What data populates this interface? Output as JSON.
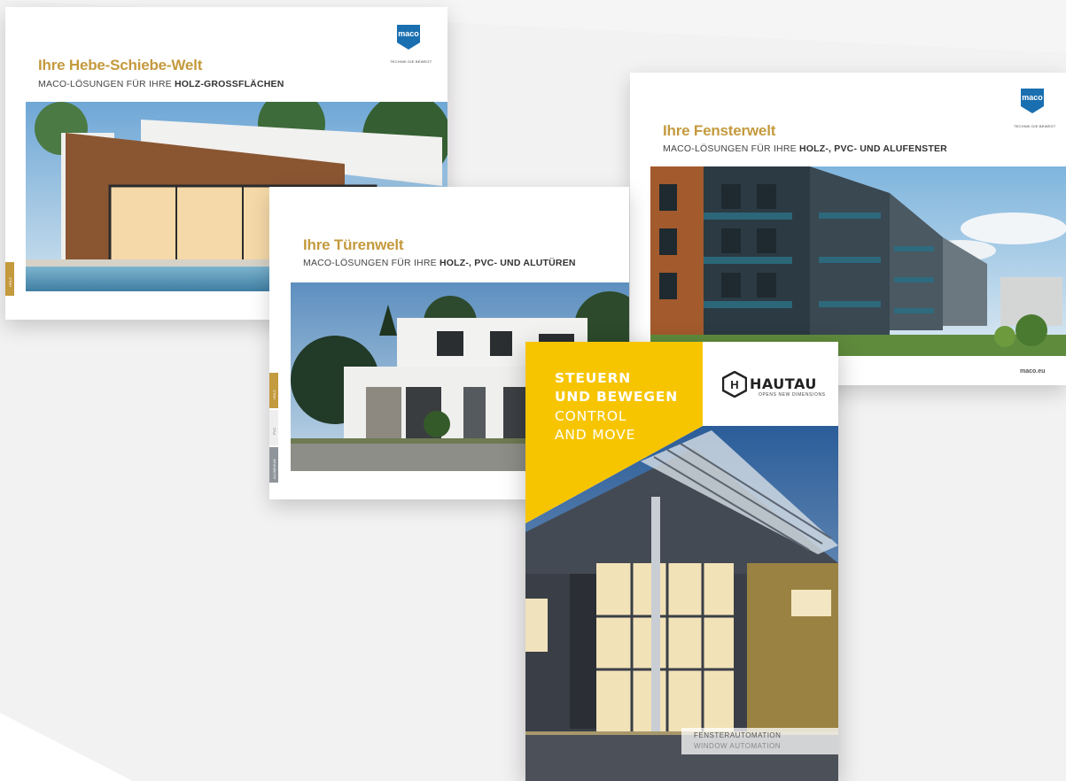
{
  "brochures": [
    {
      "title": "Ihre Hebe-Schiebe-Welt",
      "subtitle_plain": "MACO-LÖSUNGEN FÜR IHRE ",
      "subtitle_bold": "HOLZ-GROSSFLÄCHEN",
      "logo_tagline": "TECHNIK DIE BEWEGT",
      "tabs": [
        "HOLZ"
      ]
    },
    {
      "title": "Ihre Türenwelt",
      "subtitle_plain": "MACO-LÖSUNGEN FÜR IHRE ",
      "subtitle_bold": "HOLZ-, PVC- UND ALUTÜREN",
      "tabs": [
        "HOLZ",
        "PVC",
        "ALUMINIUM"
      ]
    },
    {
      "title": "Ihre Fensterwelt",
      "subtitle_plain": "MACO-LÖSUNGEN FÜR IHRE ",
      "subtitle_bold": "HOLZ-, PVC- UND ALUFENSTER",
      "logo_tagline": "TECHNIK DIE BEWEGT",
      "url": "maco.eu"
    },
    {
      "headline": [
        "STEUERN",
        "UND BEWEGEN"
      ],
      "headline_en": [
        "CONTROL",
        "AND MOVE"
      ],
      "brand": "HAUTAU",
      "brand_tagline": "OPENS NEW DIMENSIONS",
      "footer_label": "FENSTERAUTOMATION",
      "footer_label_en": "WINDOW AUTOMATION"
    }
  ],
  "colors": {
    "maco_gold": "#c49a3e",
    "maco_blue": "#1a6fb0",
    "hautau_yellow": "#f7c500",
    "background": "#f3f2f3"
  }
}
